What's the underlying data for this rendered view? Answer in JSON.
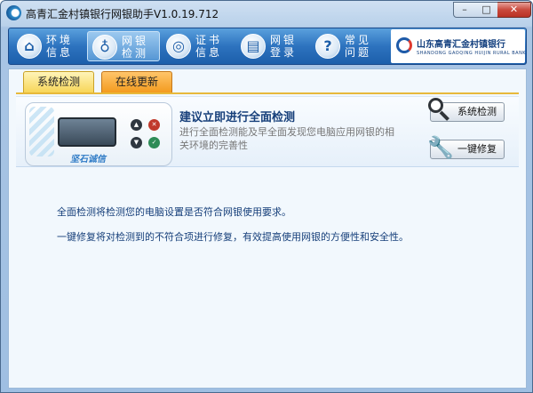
{
  "window": {
    "title": "高青汇金村镇银行网银助手V1.0.19.712",
    "controls": {
      "minimize": "–",
      "maximize": "□",
      "close": "✕"
    }
  },
  "nav": {
    "items": [
      {
        "label": "环境信息",
        "icon": "home-icon"
      },
      {
        "label": "网银检测",
        "icon": "stethoscope-icon",
        "active": true
      },
      {
        "label": "证书信息",
        "icon": "certificate-icon"
      },
      {
        "label": "网银登录",
        "icon": "login-icon"
      },
      {
        "label": "常见问题",
        "icon": "question-icon"
      }
    ],
    "logo": {
      "name": "山东高青汇金村镇银行",
      "subtitle": "SHANDONG GAOQING HUIJIN RURAL BANK"
    }
  },
  "tabs": [
    {
      "label": "系统检测",
      "active": true
    },
    {
      "label": "在线更新",
      "active": false
    }
  ],
  "panel": {
    "device_brand": "坚石诚信",
    "title": "建议立即进行全面检测",
    "description": "进行全面检测能及早全面发现您电脑应用网银的相关环境的完善性",
    "buttons": {
      "scan": "系统检测",
      "repair": "一键修复"
    }
  },
  "info": {
    "line1": "全面检测将检测您的电脑设置是否符合网银使用要求。",
    "line2": "一键修复将对检测到的不符合项进行修复，有效提高使用网银的方便性和安全性。"
  },
  "colors": {
    "nav_bg": "#2d73bf",
    "tab_active": "#f7d659",
    "tab_inactive": "#f39b1f",
    "title_text": "#163f7a"
  }
}
